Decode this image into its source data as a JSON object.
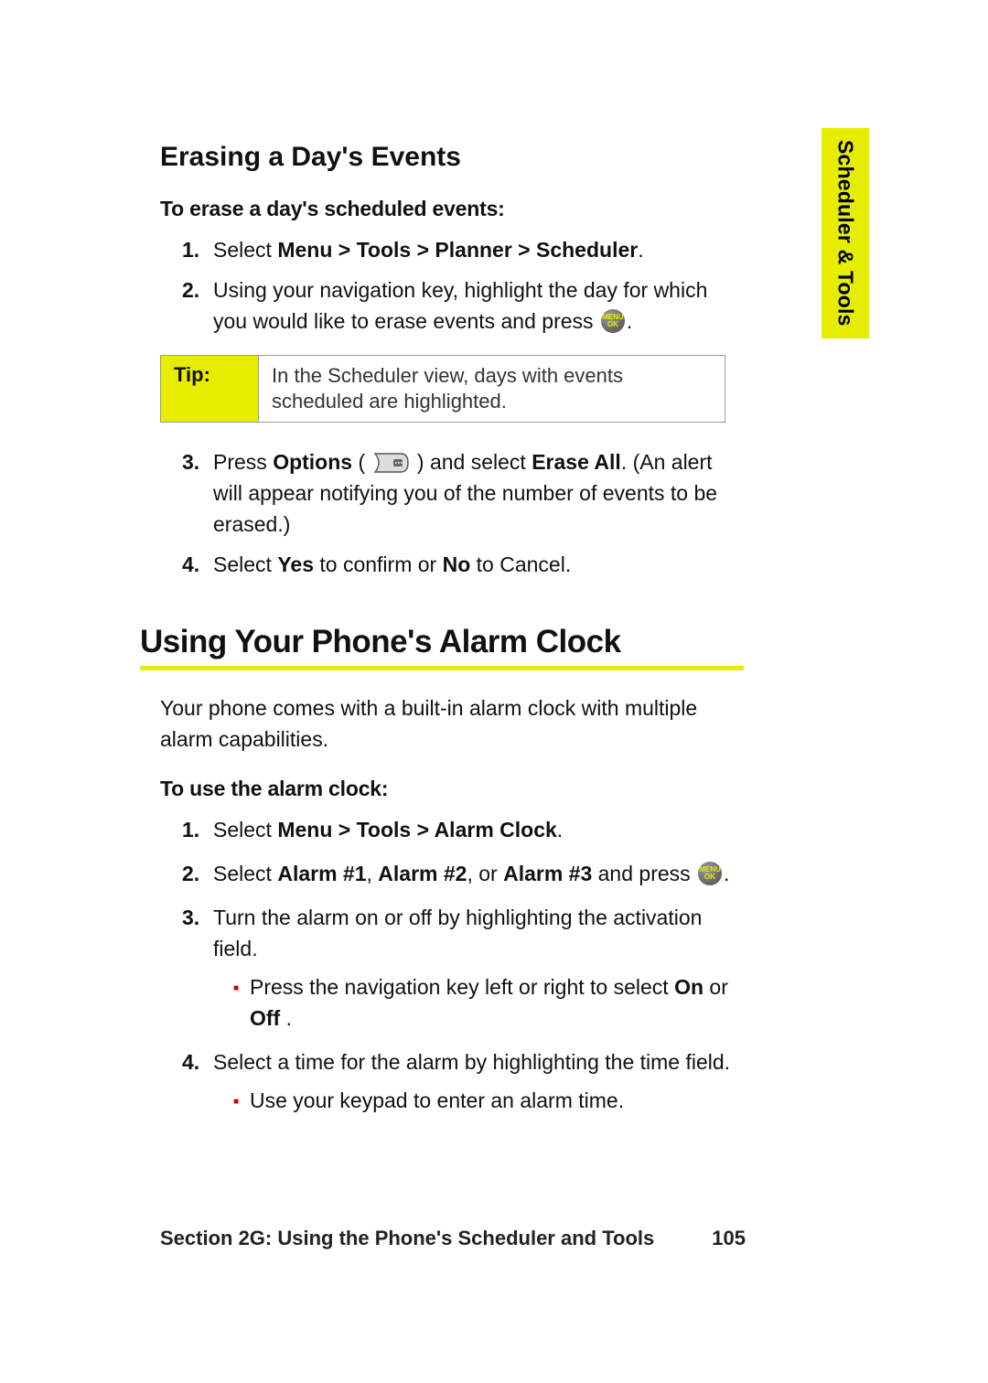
{
  "sideTab": "Scheduler & Tools",
  "section1": {
    "title": "Erasing a Day's Events",
    "lead": "To erase a day's scheduled events:",
    "step1_pre": "Select ",
    "step1_bold": "Menu > Tools > Planner > Scheduler",
    "step1_post": ".",
    "step2_a": "Using your navigation key, highlight the day for which you would like to erase events and press ",
    "step2_b": ".",
    "tipLabel": "Tip:",
    "tipText": "In the Scheduler view, days with events scheduled are highlighted.",
    "step3_a": "Press ",
    "step3_bold1": "Options",
    "step3_b": " ( ",
    "step3_c": " ) and select ",
    "step3_bold2": "Erase All",
    "step3_d": ". (An alert will appear notifying you of the number of events to be erased.)",
    "step4_a": "Select ",
    "step4_bold1": "Yes",
    "step4_b": " to confirm or ",
    "step4_bold2": "No",
    "step4_c": " to Cancel."
  },
  "section2": {
    "title": "Using Your Phone's Alarm Clock",
    "intro": "Your phone comes with a built-in alarm clock with multiple alarm capabilities.",
    "lead": "To use the alarm clock:",
    "step1_pre": "Select ",
    "step1_bold": "Menu > Tools > Alarm Clock",
    "step1_post": ".",
    "step2_a": "Select ",
    "step2_b1": "Alarm #1",
    "step2_c": ", ",
    "step2_b2": "Alarm #2",
    "step2_d": ", or ",
    "step2_b3": "Alarm #3",
    "step2_e": " and press ",
    "step2_f": ".",
    "step3": "Turn the alarm on or off by highlighting the activation field.",
    "step3_sub_a": "Press the navigation key left or right to select ",
    "step3_sub_b1": "On",
    "step3_sub_b": " or ",
    "step3_sub_b2": "Off",
    "step3_sub_c": " .",
    "step4": "Select a time for the alarm by highlighting the time field.",
    "step4_sub": "Use your keypad to enter an alarm time."
  },
  "footer": {
    "left": "Section 2G: Using the Phone's Scheduler and Tools",
    "right": "105"
  },
  "okLabel": "MENU\nOK"
}
